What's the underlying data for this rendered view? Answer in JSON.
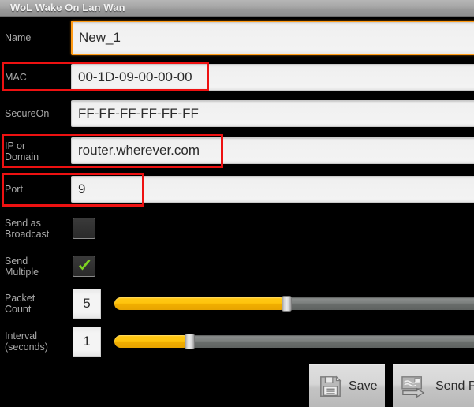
{
  "window": {
    "title": "WoL Wake On Lan Wan"
  },
  "form": {
    "fields": [
      {
        "label": "Name",
        "value": "New_1",
        "focused": true,
        "highlighted": false
      },
      {
        "label": "MAC",
        "value": "00-1D-09-00-00-00",
        "focused": false,
        "highlighted": true
      },
      {
        "label": "SecureOn",
        "value": "FF-FF-FF-FF-FF-FF",
        "focused": false,
        "highlighted": false
      },
      {
        "label": "IP or\nDomain",
        "value": "router.wherever.com",
        "focused": false,
        "highlighted": true
      },
      {
        "label": "Port",
        "value": "9",
        "focused": false,
        "highlighted": true
      }
    ],
    "checkboxes": [
      {
        "label": "Send as\nBroadcast",
        "checked": false
      },
      {
        "label": "Send\nMultiple",
        "checked": true
      }
    ],
    "sliders": [
      {
        "label": "Packet\nCount",
        "value": "5"
      },
      {
        "label": "Interval\n(seconds)",
        "value": "1"
      }
    ]
  },
  "buttons": [
    {
      "label": "Save",
      "icon": "save-floppy-icon"
    },
    {
      "label": "Send Pac",
      "icon": "send-packet-icon"
    }
  ],
  "colors": {
    "accent_orange": "#ff9a13",
    "slider_fill": "#ffc40d",
    "checkmark_green": "#7ed321",
    "annotation_red": "#ee1111",
    "background": "#000000",
    "titlebar": "#a8a8a8"
  }
}
